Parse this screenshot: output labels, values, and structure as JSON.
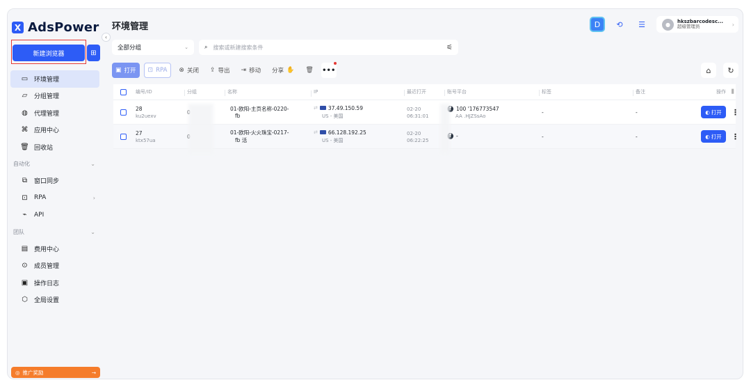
{
  "app": {
    "logo_text": "AdsPower",
    "logo_mark": "X"
  },
  "sidebar": {
    "new_browser_label": "新建浏览器",
    "items_main": [
      {
        "label": "环境管理",
        "icon": "window-icon",
        "active": true
      },
      {
        "label": "分组管理",
        "icon": "folder-icon"
      },
      {
        "label": "代理管理",
        "icon": "proxy-icon"
      },
      {
        "label": "应用中心",
        "icon": "apps-icon"
      },
      {
        "label": "回收站",
        "icon": "trash-icon"
      }
    ],
    "section_automation": "自动化",
    "items_automation": [
      {
        "label": "窗口同步",
        "icon": "sync-icon"
      },
      {
        "label": "RPA",
        "icon": "rpa-icon"
      },
      {
        "label": "API",
        "icon": "api-icon"
      }
    ],
    "section_team": "团队",
    "items_team": [
      {
        "label": "费用中心",
        "icon": "billing-icon"
      },
      {
        "label": "成员管理",
        "icon": "members-icon"
      },
      {
        "label": "操作日志",
        "icon": "log-icon"
      },
      {
        "label": "全局设置",
        "icon": "settings-icon"
      }
    ],
    "promo_label": "推广奖励"
  },
  "header": {
    "title": "环境管理",
    "user_name": "hkszbarcodesc...",
    "user_role": "超级管理员"
  },
  "filters": {
    "group_value": "全部分组",
    "search_placeholder": "搜索或新建搜索条件"
  },
  "toolbar": {
    "open": "打开",
    "rpa": "RPA",
    "close": "关闭",
    "export": "导出",
    "move": "移动",
    "share": "分享",
    "more": "•••"
  },
  "table": {
    "columns": {
      "id": "编号/ID",
      "group": "分组",
      "name": "名称",
      "ip": "IP",
      "last_open": "最近打开",
      "account": "账号平台",
      "tag": "标签",
      "note": "备注",
      "op": "操作"
    },
    "rows": [
      {
        "num": "28",
        "id": "ku2uexv",
        "group": "0",
        "name1": "01-欧阳-主页名称-0220-",
        "name2": "fb",
        "ip": "37.49.150.59",
        "ip_loc": "US - 美国",
        "date": "02-20",
        "time": "06:31:01",
        "acct1": "100   '176773547",
        "acct2": "AA    .HJZSsAo",
        "tag": "-",
        "note": "-",
        "open": "打开"
      },
      {
        "num": "27",
        "id": "ktx57ua",
        "group": "0",
        "name1": "01-欧阳-火火珠宝-0217-",
        "name2": "fb 活",
        "ip": "66.128.192.25",
        "ip_loc": "US - 美国",
        "date": "02-20",
        "time": "06:22:25",
        "acct1": "-",
        "acct2": "",
        "tag": "-",
        "note": "-",
        "open": "打开"
      }
    ]
  },
  "colors": {
    "primary": "#2d5cf6",
    "active_nav": "#dde5fb",
    "promo": "#f57c2b",
    "highlight_outline": "#e53935"
  }
}
